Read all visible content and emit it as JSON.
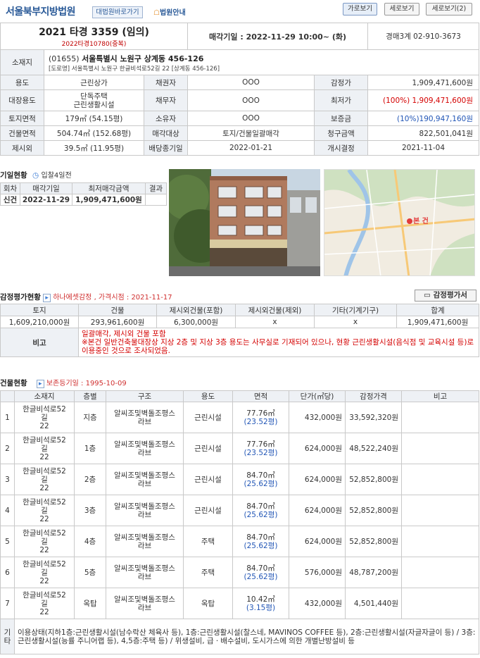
{
  "header": {
    "court_name": "서울북부지방법원",
    "goto_button": "대법원바로가기",
    "court_info": "법원안내",
    "view_buttons": [
      "가로보기",
      "세로보기",
      "세로보기(2)"
    ]
  },
  "case": {
    "number": "2021 타경 3359 (임의)",
    "dup": "2022타경10780(중복)",
    "sale_date_label": "매각기일 : 2022-11-29 10:00~ (화)",
    "department": "경매3계 02-910-3673"
  },
  "location": {
    "label": "소재지",
    "line1_zip": "(01655)",
    "line1_addr": "서울특별시 노원구 상계동 456-126",
    "line2": "[도로명]  서울특별시 노원구 한글비석로52길 22 [상계동 456-126]"
  },
  "details": {
    "use_label": "용도",
    "use_value": "근린상가",
    "creditor_label": "채권자",
    "creditor_value": "OOO",
    "appraisal_label": "감정가",
    "appraisal_value": "1,909,471,600원",
    "main_use_label": "대장용도",
    "main_use_value": "단독주택\n근린생활시설",
    "debtor_label": "채무자",
    "debtor_value": "OOO",
    "min_label": "최저가",
    "min_value": "(100%) 1,909,471,600원",
    "land_label": "토지면적",
    "land_value": "179㎡ (54.15평)",
    "owner_label": "소유자",
    "owner_value": "OOO",
    "deposit_label": "보증금",
    "deposit_value": "(10%)190,947,160원",
    "building_label": "건물면적",
    "building_value": "504.74㎡ (152.68평)",
    "target_label": "매각대상",
    "target_value": "토지/건물일괄매각",
    "claim_label": "청구금액",
    "claim_value": "822,501,041원",
    "excluded_label": "제시외",
    "excluded_value": "39.5㎡ (11.95평)",
    "deadline_label": "배당종기일",
    "deadline_value": "2022-01-21",
    "start_label": "개시결정",
    "start_value": "2021-11-04"
  },
  "schedule": {
    "title": "기일현황",
    "sub": "입찰4일전",
    "headers": [
      "회차",
      "매각기일",
      "최저매각금액",
      "결과"
    ],
    "rows": [
      [
        "신건",
        "2022-11-29",
        "1,909,471,600원",
        ""
      ]
    ]
  },
  "appraisal": {
    "title": "감정평가현황",
    "sub": "하나에셋감정 , 가격시점 : 2021-11-17",
    "button": "감정평가서",
    "headers": [
      "토지",
      "건물",
      "제시외건물(포함)",
      "제시외건물(제외)",
      "기타(기계기구)",
      "합계"
    ],
    "values": [
      "1,609,210,000원",
      "293,961,600원",
      "6,300,000원",
      "x",
      "x",
      "1,909,471,600원"
    ],
    "note_label": "비고",
    "note": "일괄매각, 제시외 건물 포함\n※본건 일반건축물대장상 지상 2층 및 지상 3층 용도는 사무실로 기재되어 있으나, 현황 근린생활시설(음식점 및 교육시설 등)로 이용중인 것으로 조사되었음."
  },
  "buildings": {
    "title": "건물현황",
    "sub": "보존등기일 : 1995-10-09",
    "headers": [
      "",
      "소재지",
      "층별",
      "구조",
      "용도",
      "면적",
      "단가(㎡당)",
      "감정가격",
      "비고"
    ],
    "rows": [
      {
        "no": "1",
        "loc": "한글비석로52\n길\n22",
        "floor": "지층",
        "struct": "알씨조및벽돌조평스\n라브",
        "use": "근린시설",
        "area": "77.76㎡",
        "pyeong": "(23.52평)",
        "price": "432,000원",
        "value": "33,592,320원"
      },
      {
        "no": "2",
        "loc": "한글비석로52\n길\n22",
        "floor": "1층",
        "struct": "알씨조및벽돌조평스\n라브",
        "use": "근린시설",
        "area": "77.76㎡",
        "pyeong": "(23.52평)",
        "price": "624,000원",
        "value": "48,522,240원"
      },
      {
        "no": "3",
        "loc": "한글비석로52\n길\n22",
        "floor": "2층",
        "struct": "알씨조및벽돌조평스\n라브",
        "use": "근린시설",
        "area": "84.70㎡",
        "pyeong": "(25.62평)",
        "price": "624,000원",
        "value": "52,852,800원"
      },
      {
        "no": "4",
        "loc": "한글비석로52\n길\n22",
        "floor": "3층",
        "struct": "알씨조및벽돌조평스\n라브",
        "use": "근린시설",
        "area": "84.70㎡",
        "pyeong": "(25.62평)",
        "price": "624,000원",
        "value": "52,852,800원"
      },
      {
        "no": "5",
        "loc": "한글비석로52\n길\n22",
        "floor": "4층",
        "struct": "알씨조및벽돌조평스\n라브",
        "use": "주택",
        "area": "84.70㎡",
        "pyeong": "(25.62평)",
        "price": "624,000원",
        "value": "52,852,800원"
      },
      {
        "no": "6",
        "loc": "한글비석로52\n길\n22",
        "floor": "5층",
        "struct": "알씨조및벽돌조평스\n라브",
        "use": "주택",
        "area": "84.70㎡",
        "pyeong": "(25.62평)",
        "price": "576,000원",
        "value": "48,787,200원"
      },
      {
        "no": "7",
        "loc": "한글비석로52\n길\n22",
        "floor": "옥탑",
        "struct": "알씨조및벽돌조평스\n라브",
        "use": "옥탑",
        "area": "10.42㎡",
        "pyeong": "(3.15평)",
        "price": "432,000원",
        "value": "4,501,440원"
      }
    ],
    "etc_label": "기타",
    "etc": "이용상태(지하1층:근린생활시설(남수락산 체육사 등), 1층:근린생활시설(찰스네, MAVINOS COFFEE 등), 2층:근린생활시설(자글자글이 등) / 3층:근린생활시설(능률 주니어랩 등), 4,5층:주택 등) / 위생설비, 급ㆍ배수설비, 도시가스에 의한 개별난방설비 등"
  },
  "map": {
    "marker": "본 건"
  }
}
